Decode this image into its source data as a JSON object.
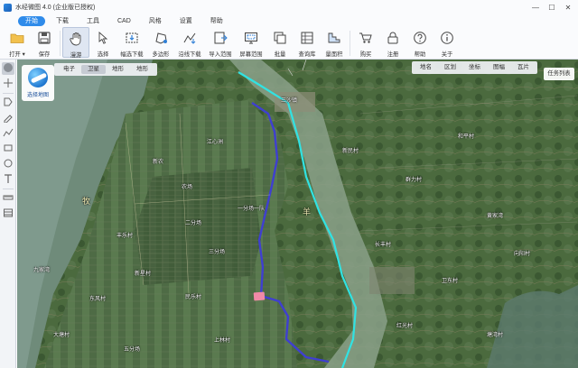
{
  "window": {
    "title": "水经微图 4.0 (企业版已授权)",
    "controls": [
      "—",
      "☐",
      "✕"
    ]
  },
  "menu": {
    "items": [
      {
        "label": "开始",
        "active": true
      },
      {
        "label": "下载",
        "active": false
      },
      {
        "label": "工具",
        "active": false
      },
      {
        "label": "CAD",
        "active": false
      },
      {
        "label": "风格",
        "active": false
      },
      {
        "label": "设置",
        "active": false
      },
      {
        "label": "帮助",
        "active": false
      }
    ]
  },
  "toolbar": {
    "items": [
      {
        "label": "打开 ▾",
        "icon": "folder-icon"
      },
      {
        "label": "保存",
        "icon": "save-icon"
      },
      {
        "label": "漫游",
        "icon": "hand-icon",
        "active": true
      },
      {
        "label": "选择",
        "icon": "cursor-icon"
      },
      {
        "label": "幅选下载",
        "icon": "frame-download-icon"
      },
      {
        "label": "多边形",
        "icon": "polygon-icon"
      },
      {
        "label": "沿线下载",
        "icon": "line-download-icon"
      },
      {
        "label": "导入范围",
        "icon": "import-icon"
      },
      {
        "label": "屏幕范围",
        "icon": "screen-icon"
      },
      {
        "label": "批量",
        "icon": "batch-icon"
      },
      {
        "label": "查询库",
        "icon": "query-icon"
      },
      {
        "label": "量面积",
        "icon": "area-icon"
      },
      {
        "label": "购买",
        "icon": "cart-icon"
      },
      {
        "label": "注册",
        "icon": "lock-icon"
      },
      {
        "label": "帮助",
        "icon": "help-icon"
      },
      {
        "label": "关于",
        "icon": "about-icon"
      }
    ]
  },
  "left_tools": [
    "globe-icon",
    "pan-icon",
    "tag-icon",
    "pen-icon",
    "polyline-icon",
    "rect-icon",
    "circle-icon",
    "text-icon",
    "ruler-icon",
    "table-icon"
  ],
  "map": {
    "map_types": [
      {
        "label": "电子",
        "active": false
      },
      {
        "label": "卫星",
        "active": true
      },
      {
        "label": "地形",
        "active": false
      },
      {
        "label": "地形",
        "active": false
      }
    ],
    "layers": [
      "地名",
      "区划",
      "坐标",
      "图幅",
      "瓦片"
    ],
    "map_select_label": "选择地图",
    "task_button": "任务列表",
    "road_tag": "",
    "labels": [
      {
        "text": "牧",
        "color": "yellow"
      },
      {
        "text": "羊",
        "color": "yellow"
      },
      {
        "text": "三沙镇",
        "color": "white"
      },
      {
        "text": "江心洲",
        "color": "white"
      },
      {
        "text": "一分场一队",
        "color": "white"
      },
      {
        "text": "新农",
        "color": "white"
      },
      {
        "text": "农场",
        "color": "white"
      },
      {
        "text": "丰乐村",
        "color": "white"
      },
      {
        "text": "二分场",
        "color": "white"
      },
      {
        "text": "三分场",
        "color": "white"
      },
      {
        "text": "新星村",
        "color": "white"
      },
      {
        "text": "东风村",
        "color": "white"
      },
      {
        "text": "民乐村",
        "color": "white"
      },
      {
        "text": "大塘村",
        "color": "white"
      },
      {
        "text": "九家湾",
        "color": "white"
      },
      {
        "text": "五分场",
        "color": "white"
      },
      {
        "text": "上林村",
        "color": "white"
      },
      {
        "text": "黄家湾",
        "color": "white"
      },
      {
        "text": "新民村",
        "color": "white"
      },
      {
        "text": "群力村",
        "color": "white"
      },
      {
        "text": "和平村",
        "color": "white"
      },
      {
        "text": "长丰村",
        "color": "white"
      },
      {
        "text": "卫东村",
        "color": "white"
      },
      {
        "text": "向阳村",
        "color": "white"
      },
      {
        "text": "红光村",
        "color": "white"
      },
      {
        "text": "塘湾村",
        "color": "white"
      }
    ]
  }
}
